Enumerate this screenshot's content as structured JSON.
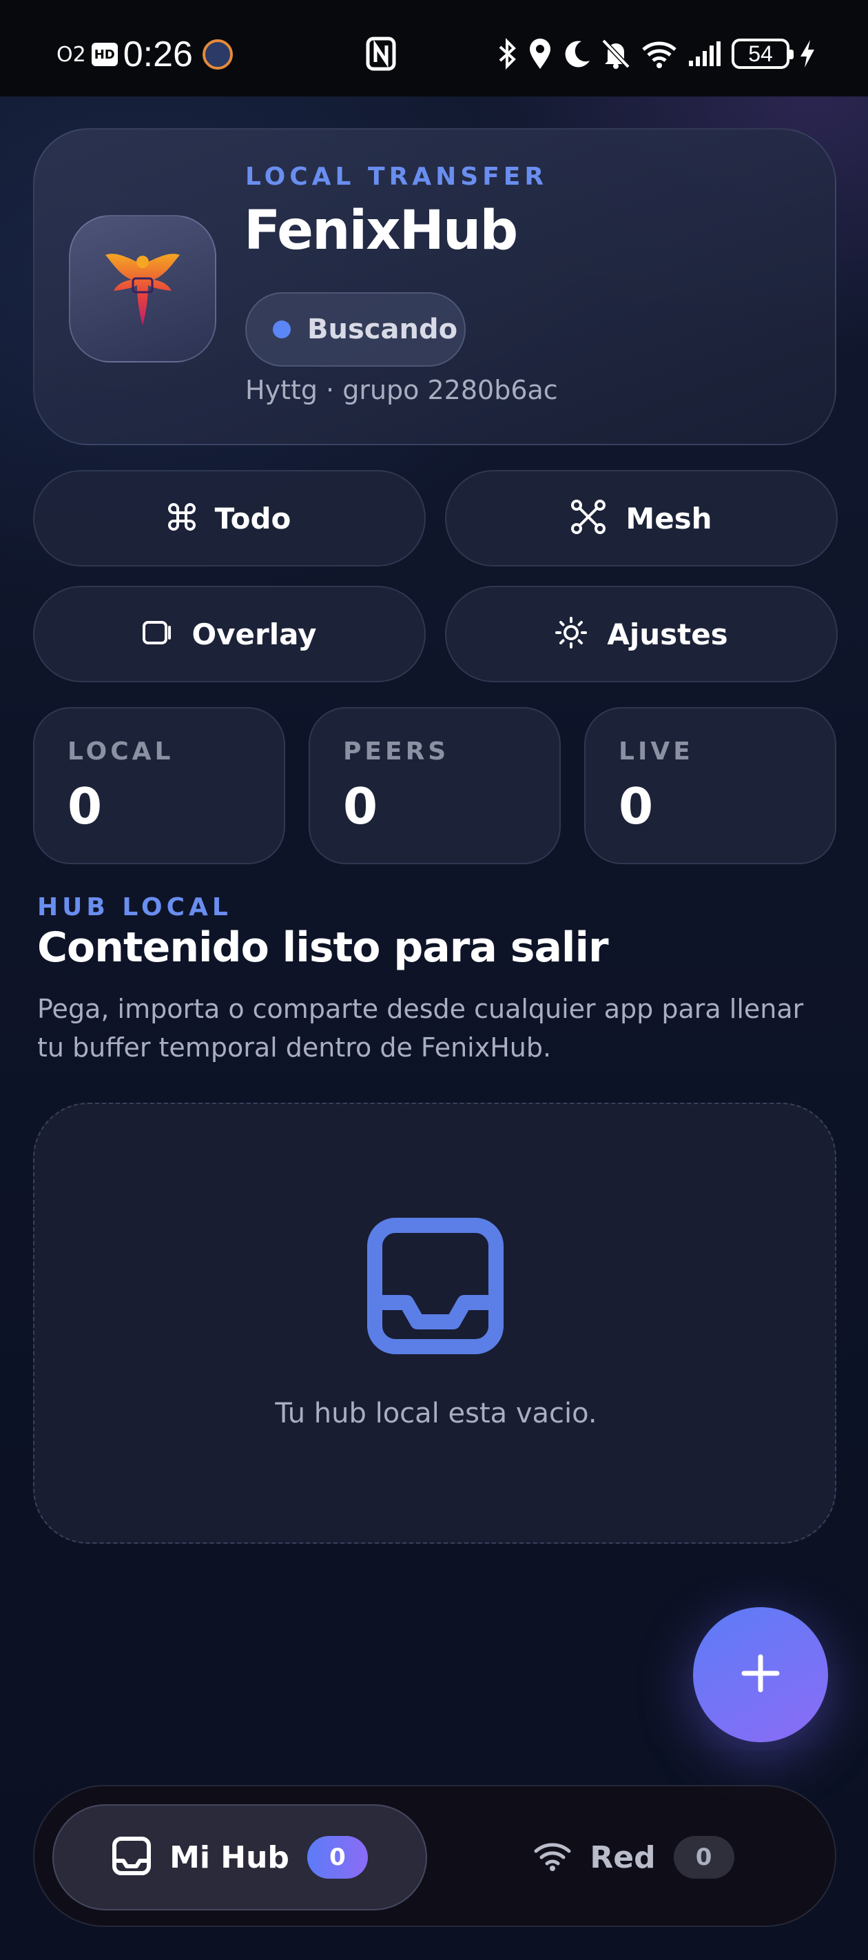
{
  "status_bar": {
    "carrier": "O2",
    "hd_badge": "HD",
    "time": "0:26",
    "battery": "54",
    "icons": [
      "nfc-icon",
      "bluetooth-icon",
      "location-icon",
      "moon-icon",
      "bell-off-icon",
      "wifi-icon",
      "signal-icon",
      "charging-icon"
    ]
  },
  "header": {
    "eyebrow": "LOCAL TRANSFER",
    "title": "FenixHub",
    "status": "Buscando",
    "device": "Hyttg · grupo 2280b6ac",
    "logo_icon": "phoenix-logo-icon"
  },
  "actions": [
    {
      "label": "Todo",
      "icon": "command-icon"
    },
    {
      "label": "Mesh",
      "icon": "mesh-icon"
    },
    {
      "label": "Overlay",
      "icon": "overlay-icon"
    },
    {
      "label": "Ajustes",
      "icon": "sun-settings-icon"
    }
  ],
  "stats": [
    {
      "label": "LOCAL",
      "value": "0"
    },
    {
      "label": "PEERS",
      "value": "0"
    },
    {
      "label": "LIVE",
      "value": "0"
    }
  ],
  "section": {
    "eyebrow": "HUB LOCAL",
    "title": "Contenido listo para salir",
    "description": "Pega, importa o comparte desde cualquier app para llenar tu buffer temporal dentro de FenixHub."
  },
  "empty_state": {
    "text": "Tu hub local esta vacio.",
    "icon": "inbox-icon"
  },
  "fab": {
    "icon": "plus-icon"
  },
  "bottom_nav": {
    "items": [
      {
        "label": "Mi Hub",
        "badge": "0",
        "icon": "inbox-icon",
        "active": true
      },
      {
        "label": "Red",
        "badge": "0",
        "icon": "wifi-icon",
        "active": false
      }
    ]
  },
  "colors": {
    "accent": "#5b86f5",
    "accent_gradient_end": "#8b6cf5",
    "eyebrow": "#6a8ef0",
    "background": "#0e1428"
  }
}
